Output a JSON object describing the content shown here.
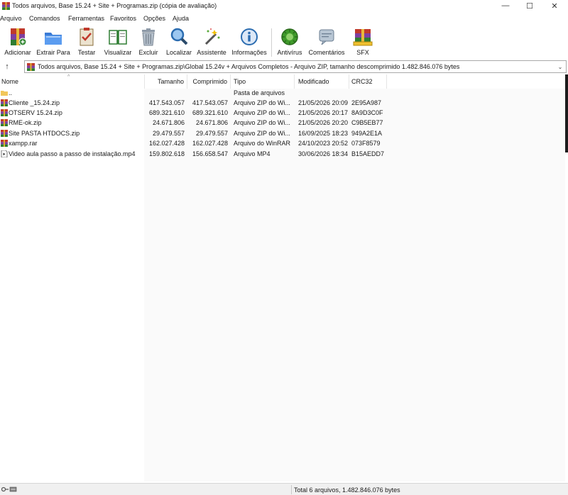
{
  "window": {
    "title": "Todos arquivos, Base 15.24 + Site + Programas.zip (cópia de avaliação)",
    "minimize": "—",
    "maximize": "☐",
    "close": "✕"
  },
  "menu": [
    "Arquivo",
    "Comandos",
    "Ferramentas",
    "Favoritos",
    "Opções",
    "Ajuda"
  ],
  "toolbar": [
    {
      "label": "Adicionar",
      "icon": "add-icon"
    },
    {
      "label": "Extrair Para",
      "icon": "extract-icon"
    },
    {
      "label": "Testar",
      "icon": "test-icon"
    },
    {
      "label": "Visualizar",
      "icon": "view-icon"
    },
    {
      "label": "Excluir",
      "icon": "delete-icon"
    },
    {
      "label": "Localizar",
      "icon": "find-icon"
    },
    {
      "label": "Assistente",
      "icon": "wizard-icon"
    },
    {
      "label": "Informações",
      "icon": "info-icon"
    },
    {
      "label": "Antivírus",
      "icon": "antivirus-icon"
    },
    {
      "label": "Comentários",
      "icon": "comment-icon"
    },
    {
      "label": "SFX",
      "icon": "sfx-icon"
    }
  ],
  "address": {
    "up": "↑",
    "path": "Todos arquivos, Base 15.24 + Site + Programas.zip\\Global 15.24v + Arquivos Completos - Arquivo ZIP, tamanho descomprimido 1.482.846.076 bytes",
    "dropdown": "⌄"
  },
  "columns": {
    "name": "Nome",
    "size": "Tamanho",
    "packed": "Comprimido",
    "type": "Tipo",
    "modified": "Modificado",
    "crc": "CRC32",
    "sort_indicator": "^"
  },
  "files": [
    {
      "name": "..",
      "size": "",
      "packed": "",
      "type": "Pasta de arquivos",
      "modified": "",
      "crc": "",
      "icon": "folder-icon"
    },
    {
      "name": "Cliente _15.24.zip",
      "size": "417.543.057",
      "packed": "417.543.057",
      "type": "Arquivo ZIP do Wi...",
      "modified": "21/05/2026 20:09",
      "crc": "2E95A987",
      "icon": "winrar-archive-icon"
    },
    {
      "name": "OTSERV 15.24.zip",
      "size": "689.321.610",
      "packed": "689.321.610",
      "type": "Arquivo ZIP do Wi...",
      "modified": "21/05/2026 20:17",
      "crc": "8A9D3C0F",
      "icon": "winrar-archive-icon"
    },
    {
      "name": "RME-ok.zip",
      "size": "24.671.806",
      "packed": "24.671.806",
      "type": "Arquivo ZIP do Wi...",
      "modified": "21/05/2026 20:20",
      "crc": "C9B5EB77",
      "icon": "winrar-archive-icon"
    },
    {
      "name": "Site PASTA HTDOCS.zip",
      "size": "29.479.557",
      "packed": "29.479.557",
      "type": "Arquivo ZIP do Wi...",
      "modified": "16/09/2025 18:23",
      "crc": "949A2E1A",
      "icon": "winrar-archive-icon"
    },
    {
      "name": "xampp.rar",
      "size": "162.027.428",
      "packed": "162.027.428",
      "type": "Arquivo do WinRAR",
      "modified": "24/10/2023 20:52",
      "crc": "073F8579",
      "icon": "winrar-archive-icon"
    },
    {
      "name": "Video aula passo a passo de instalação.mp4",
      "size": "159.802.618",
      "packed": "156.658.547",
      "type": "Arquivo MP4",
      "modified": "30/06/2026 18:34",
      "crc": "B15AEDD7",
      "icon": "video-file-icon"
    }
  ],
  "status": {
    "text": "Total 6 arquivos, 1.482.846.076 bytes",
    "icons": "status-key-drive-icon"
  }
}
